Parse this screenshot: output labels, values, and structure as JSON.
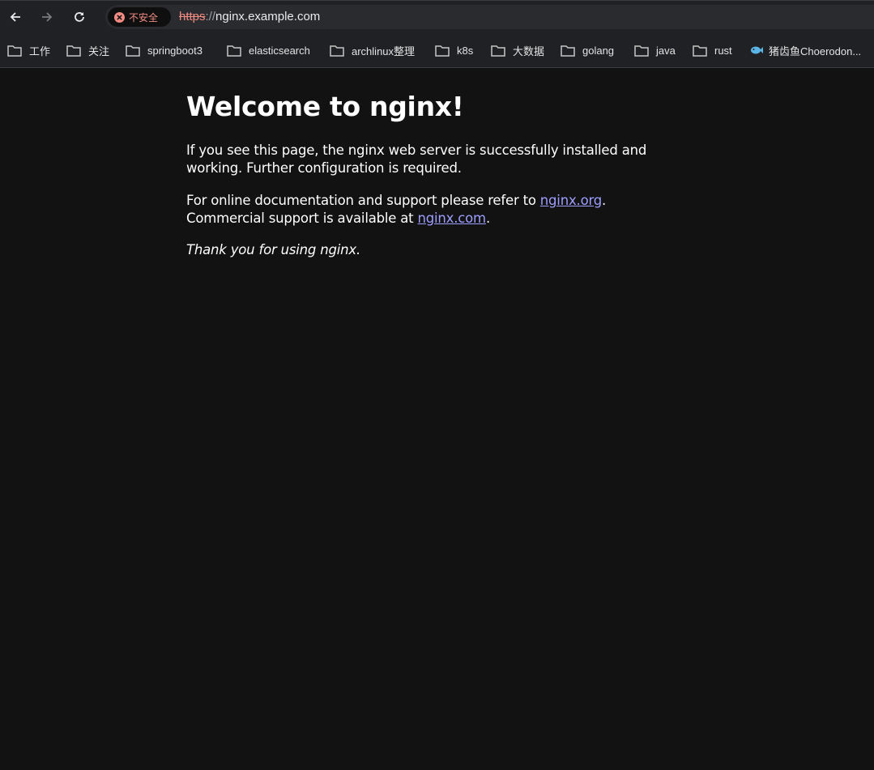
{
  "browser": {
    "security_label": "不安全",
    "url": {
      "scheme": "https",
      "separator": "://",
      "host": "nginx.example.com"
    },
    "bookmarks": [
      {
        "label": "工作",
        "icon": "folder-icon"
      },
      {
        "label": "关注",
        "icon": "folder-icon"
      },
      {
        "label": "springboot3",
        "icon": "folder-icon"
      },
      {
        "label": "elasticsearch",
        "icon": "folder-icon"
      },
      {
        "label": "archlinux整理",
        "icon": "folder-icon"
      },
      {
        "label": "k8s",
        "icon": "folder-icon"
      },
      {
        "label": "大数据",
        "icon": "folder-icon"
      },
      {
        "label": "golang",
        "icon": "folder-icon"
      },
      {
        "label": "java",
        "icon": "folder-icon"
      },
      {
        "label": "rust",
        "icon": "folder-icon"
      },
      {
        "label": "猪齿鱼Choerodon...",
        "icon": "fish-icon"
      }
    ]
  },
  "content": {
    "title": "Welcome to nginx!",
    "p1_line1": "If you see this page, the nginx web server is successfully installed and",
    "p1_line2": "working. Further configuration is required.",
    "p2_prefix": "For online documentation and support please refer to ",
    "p2_link": "nginx.org",
    "p2_suffix": ".",
    "p2_line2_prefix": "Commercial support is available at ",
    "p2_link2": "nginx.com",
    "p2_line2_suffix": ".",
    "p3": "Thank you for using nginx."
  },
  "colors": {
    "background": "#121212",
    "link": "#9e9eff",
    "insecure": "#f28b82"
  }
}
